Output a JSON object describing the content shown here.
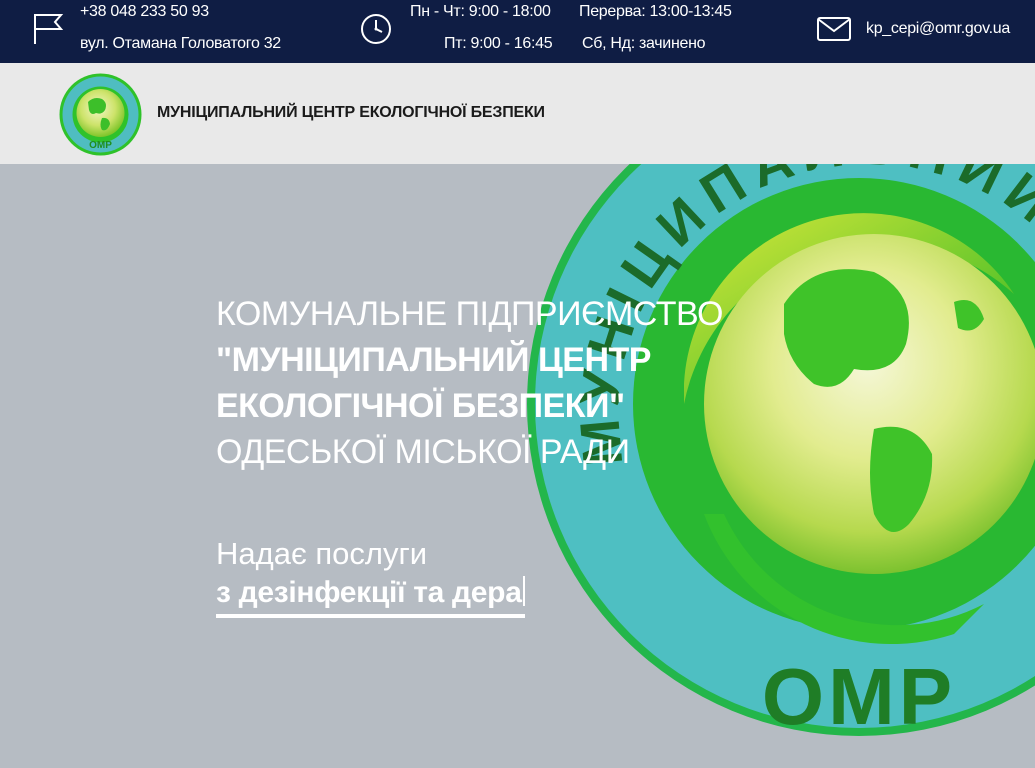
{
  "topbar": {
    "phone": "+38 048 233 50 93",
    "address": "вул. Отамана Головатого 32",
    "hours_weekdays": "Пн - Чт: 9:00 - 18:00",
    "hours_friday": "Пт: 9:00 - 16:45",
    "break": "Перерва: 13:00-13:45",
    "weekend": "Сб, Нд: зачинено",
    "email": "kp_cepi@omr.gov.ua"
  },
  "header": {
    "site_name": "МУНІЦИПАЛЬНИЙ ЦЕНТР ЕКОЛОГІЧНОЇ БЕЗПЕКИ",
    "logo_text_bottom": "ОМР"
  },
  "hero": {
    "line1": "КОМУНАЛЬНЕ ПІДПРИЄМСТВО",
    "line2": "\"МУНІЦИПАЛЬНИЙ ЦЕНТР",
    "line3": "ЕКОЛОГІЧНОЇ БЕЗПЕКИ\"",
    "line4": "ОДЕСЬКОЇ МІСЬКОЇ РАДИ",
    "services_lead": "Надає послуги",
    "services_typed": "з дезінфекції та дера",
    "emblem_ring_text": "МУНІЦИПАЛЬНИЙ ЦЕНТР ЕКОЛОГІ",
    "emblem_bottom": "ОМР"
  },
  "colors": {
    "topbar_bg": "#0f1d44",
    "header_bg": "#e9e9e9",
    "hero_bg": "#b6bcc3",
    "emblem_teal": "#4fbdc1",
    "emblem_green": "#2fc22a"
  }
}
